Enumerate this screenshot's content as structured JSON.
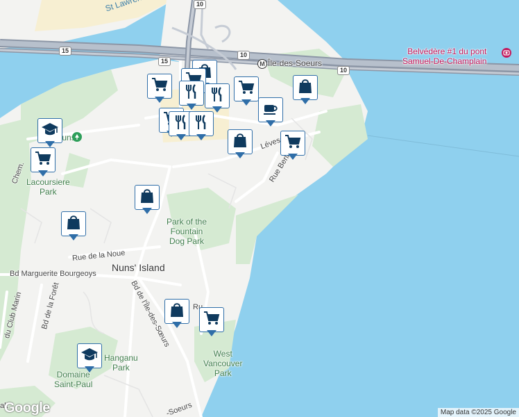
{
  "map": {
    "water_label": "St Lawrence Ri",
    "place_labels": {
      "nuns_island": "Nuns' Island",
      "ile_des_soeurs": "Île-des-Soeurs",
      "plus_nuns": "Plus Nuns",
      "lacoursiere": "Lacoursiere\nPark",
      "fountain": "Park of the\nFountain\nDog Park",
      "west_vancouver": "West\nVancouver\nPark",
      "hanganu": "Hanganu\nPark",
      "domaine": "Domaine\nSaint-Paul",
      "belvedere": "Belvédère #1 du pont\nSamuel-De-Champlain"
    },
    "street_labels": {
      "noue": "Rue de la Noue",
      "marguerite": "Bd Marguerite Bourgeoys",
      "ile_soeurs": "Bd de l'Île-des-Sœurs",
      "foret": "Bd de la Forêt",
      "club": "du Club Marin",
      "berlioz": "Rue Berlioz",
      "leves": "Lévesque",
      "chem": "Chem.",
      "ru": "Ru",
      "soeurs_bottom": "-Soeurs",
      "alt": "alt"
    },
    "highway_shields": [
      "10",
      "15",
      "15",
      "10",
      "10"
    ],
    "branding": "Google",
    "attribution": "Map data ©2025 Google",
    "colors": {
      "water": "#8fd0ee",
      "land": "#f3f3f1",
      "park": "#d5ead2",
      "marker": "#2f6ea8",
      "icon": "#0f3a5e",
      "poi": "#c2185b"
    }
  },
  "markers": [
    {
      "type": "store",
      "icon": "shopping-bag-icon"
    },
    {
      "type": "grocery",
      "icon": "shopping-cart-icon"
    },
    {
      "type": "grocery",
      "icon": "shopping-cart-icon"
    },
    {
      "type": "restaurant",
      "icon": "fork-knife-icon"
    },
    {
      "type": "grocery",
      "icon": "shopping-cart-icon"
    },
    {
      "type": "store",
      "icon": "shopping-bag-icon"
    },
    {
      "type": "cafe",
      "icon": "coffee-cup-icon"
    },
    {
      "type": "restaurant",
      "icon": "fork-knife-icon"
    },
    {
      "type": "grocery",
      "icon": "shopping-cart-icon"
    },
    {
      "type": "restaurant",
      "icon": "fork-knife-icon"
    },
    {
      "type": "restaurant",
      "icon": "fork-knife-icon"
    },
    {
      "type": "store",
      "icon": "shopping-bag-icon"
    },
    {
      "type": "grocery",
      "icon": "shopping-cart-icon"
    },
    {
      "type": "school",
      "icon": "graduation-cap-icon"
    },
    {
      "type": "grocery",
      "icon": "shopping-cart-icon"
    },
    {
      "type": "store",
      "icon": "shopping-bag-icon"
    },
    {
      "type": "store",
      "icon": "shopping-bag-icon"
    },
    {
      "type": "store",
      "icon": "shopping-bag-icon"
    },
    {
      "type": "grocery",
      "icon": "shopping-cart-icon"
    },
    {
      "type": "school",
      "icon": "graduation-cap-icon"
    }
  ]
}
